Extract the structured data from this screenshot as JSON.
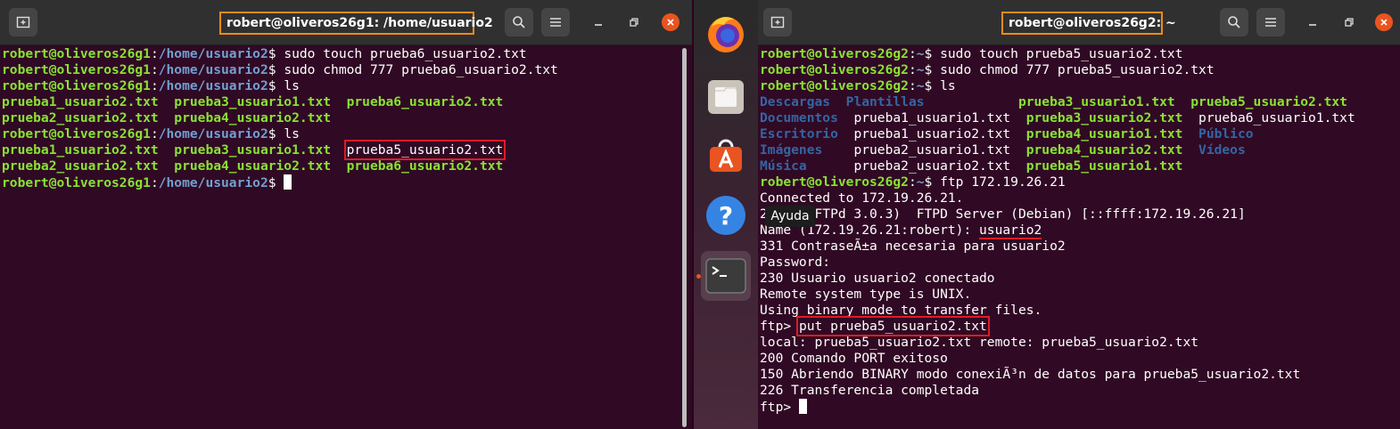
{
  "terminal1": {
    "title": "robert@oliveros26g1: /home/usuario2",
    "lines": [
      [
        {
          "t": "robert@oliveros26g1",
          "c": "u"
        },
        {
          "t": ":"
        },
        {
          "t": "/home/usuario2",
          "c": "p"
        },
        {
          "t": "$ sudo touch prueba6_usuario2.txt"
        }
      ],
      [
        {
          "t": "robert@oliveros26g1",
          "c": "u"
        },
        {
          "t": ":"
        },
        {
          "t": "/home/usuario2",
          "c": "p"
        },
        {
          "t": "$ sudo chmod 777 prueba6_usuario2.txt"
        }
      ],
      [
        {
          "t": "robert@oliveros26g1",
          "c": "u"
        },
        {
          "t": ":"
        },
        {
          "t": "/home/usuario2",
          "c": "p"
        },
        {
          "t": "$ ls"
        }
      ],
      [
        {
          "t": "prueba1_usuario2.txt  ",
          "c": "g"
        },
        {
          "t": "prueba3_usuario1.txt  ",
          "c": "g"
        },
        {
          "t": "prueba6_usuario2.txt",
          "c": "g"
        }
      ],
      [
        {
          "t": "prueba2_usuario2.txt  ",
          "c": "g"
        },
        {
          "t": "prueba4_usuario2.txt",
          "c": "g"
        }
      ],
      [
        {
          "t": "robert@oliveros26g1",
          "c": "u"
        },
        {
          "t": ":"
        },
        {
          "t": "/home/usuario2",
          "c": "p"
        },
        {
          "t": "$ ls"
        }
      ],
      [
        {
          "t": "prueba1_usuario2.txt  ",
          "c": "g"
        },
        {
          "t": "prueba3_usuario1.txt",
          "c": "g"
        },
        {
          "t": "  "
        },
        {
          "t": "prueba5_usuario2.txt",
          "box": true
        }
      ],
      [
        {
          "t": "prueba2_usuario2.txt  ",
          "c": "g"
        },
        {
          "t": "prueba4_usuario2.txt  ",
          "c": "g"
        },
        {
          "t": "prueba6_usuario2.txt",
          "c": "g"
        }
      ],
      [
        {
          "t": "robert@oliveros26g1",
          "c": "u"
        },
        {
          "t": ":"
        },
        {
          "t": "/home/usuario2",
          "c": "p"
        },
        {
          "t": "$ "
        },
        {
          "cursor": true
        }
      ]
    ]
  },
  "terminal2": {
    "title": "robert@oliveros26g2: ~",
    "lines": [
      [
        {
          "t": "robert@oliveros26g2",
          "c": "u"
        },
        {
          "t": ":"
        },
        {
          "t": "~",
          "c": "p"
        },
        {
          "t": "$ sudo touch prueba5_usuario2.txt"
        }
      ],
      [
        {
          "t": "robert@oliveros26g2",
          "c": "u"
        },
        {
          "t": ":"
        },
        {
          "t": "~",
          "c": "p"
        },
        {
          "t": "$ sudo chmod 777 prueba5_usuario2.txt"
        }
      ],
      [
        {
          "t": "robert@oliveros26g2",
          "c": "u"
        },
        {
          "t": ":"
        },
        {
          "t": "~",
          "c": "p"
        },
        {
          "t": "$ ls"
        }
      ],
      [
        {
          "t": "Descargas  ",
          "c": "b"
        },
        {
          "t": "Plantillas            ",
          "c": "b"
        },
        {
          "t": "prueba3_usuario1.txt  ",
          "c": "g"
        },
        {
          "t": "prueba5_usuario2.txt",
          "c": "g"
        }
      ],
      [
        {
          "t": "Documentos  ",
          "c": "b"
        },
        {
          "t": "prueba1_usuario1.txt  "
        },
        {
          "t": "prueba3_usuario2.txt  ",
          "c": "g"
        },
        {
          "t": "prueba6_usuario1.txt"
        }
      ],
      [
        {
          "t": "Escritorio  ",
          "c": "b"
        },
        {
          "t": "prueba1_usuario2.txt  "
        },
        {
          "t": "prueba4_usuario1.txt  ",
          "c": "g"
        },
        {
          "t": "Público",
          "c": "b"
        }
      ],
      [
        {
          "t": "Imágenes    ",
          "c": "b"
        },
        {
          "t": "prueba2_usuario1.txt  "
        },
        {
          "t": "prueba4_usuario2.txt  ",
          "c": "g"
        },
        {
          "t": "Vídeos",
          "c": "b"
        }
      ],
      [
        {
          "t": "Música      ",
          "c": "b"
        },
        {
          "t": "prueba2_usuario2.txt  "
        },
        {
          "t": "prueba5_usuario1.txt",
          "c": "g"
        }
      ],
      [
        {
          "t": "robert@oliveros26g2",
          "c": "u"
        },
        {
          "t": ":"
        },
        {
          "t": "~",
          "c": "p"
        },
        {
          "t": "$ ftp 172.19.26.21"
        }
      ],
      [
        {
          "t": "Connected to 172.19.26.21."
        }
      ],
      [
        {
          "t": "220 (vsFTPd 3.0.3)  FTPD Server (Debian) [::ffff:172.19.26.21]"
        }
      ],
      [
        {
          "t": "Name (172.19.26.21:robert): "
        },
        {
          "t": "usuario2",
          "u": true
        }
      ],
      [
        {
          "t": "331 ContraseÃ±a necesaria para usuario2"
        }
      ],
      [
        {
          "t": "Password:"
        }
      ],
      [
        {
          "t": "230 Usuario usuario2 conectado"
        }
      ],
      [
        {
          "t": "Remote system type is UNIX."
        }
      ],
      [
        {
          "t": "Using binary mode to transfer files."
        }
      ],
      [
        {
          "t": "ftp> "
        },
        {
          "t": "put prueba5_usuario2.txt",
          "box": true
        }
      ],
      [
        {
          "t": "local: prueba5_usuario2.txt remote: prueba5_usuario2.txt"
        }
      ],
      [
        {
          "t": "200 Comando PORT exitoso"
        }
      ],
      [
        {
          "t": "150 Abriendo BINARY modo conexiÃ³n de datos para prueba5_usuario2.txt"
        }
      ],
      [
        {
          "t": "226 Transferencia completada"
        }
      ],
      [
        {
          "t": "ftp> "
        },
        {
          "cursor": true
        }
      ]
    ]
  },
  "dock": {
    "items": [
      "firefox-icon",
      "files-icon",
      "software-icon",
      "help-icon",
      "terminal-icon"
    ],
    "tooltip": "Ayuda"
  },
  "colors": {
    "terminal_bg": "#300a24",
    "user_green": "#8ae234",
    "path_blue": "#729fcf",
    "dir_blue": "#3465a4",
    "highlight_orange": "#f08a1c",
    "highlight_red": "#e01b24"
  }
}
